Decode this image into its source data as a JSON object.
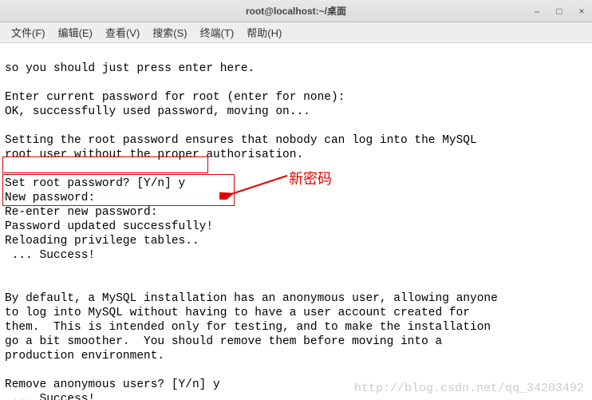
{
  "window": {
    "title": "root@localhost:~/桌面"
  },
  "menu": {
    "file": "文件(F)",
    "edit": "编辑(E)",
    "view": "查看(V)",
    "search": "搜索(S)",
    "terminal": "终端(T)",
    "help": "帮助(H)"
  },
  "lines": {
    "l0": "so you should just press enter here.",
    "l1": "",
    "l2": "Enter current password for root (enter for none):",
    "l3": "OK, successfully used password, moving on...",
    "l4": "",
    "l5": "Setting the root password ensures that nobody can log into the MySQL",
    "l6": "root user without the proper authorisation.",
    "l7": "",
    "l8": "Set root password? [Y/n] y",
    "l9": "New password:",
    "l10": "Re-enter new password:",
    "l11": "Password updated successfully!",
    "l12": "Reloading privilege tables..",
    "l13": " ... Success!",
    "l14": "",
    "l15": "",
    "l16": "By default, a MySQL installation has an anonymous user, allowing anyone",
    "l17": "to log into MySQL without having to have a user account created for",
    "l18": "them.  This is intended only for testing, and to make the installation",
    "l19": "go a bit smoother.  You should remove them before moving into a",
    "l20": "production environment.",
    "l21": "",
    "l22": "Remove anonymous users? [Y/n] y",
    "l23": " ... Success!"
  },
  "annotation": {
    "label": "新密码"
  },
  "watermark": "http://blog.csdn.net/qq_34203492"
}
